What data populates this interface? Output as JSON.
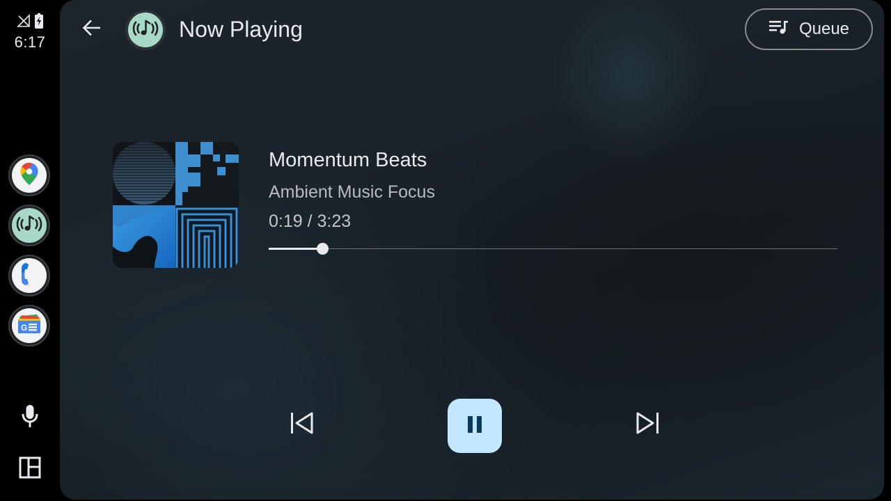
{
  "status_bar": {
    "time": "6:17",
    "icons": [
      "no-signal-icon",
      "battery-charging-icon"
    ]
  },
  "rail": {
    "apps": [
      {
        "name": "maps",
        "icon": "maps-icon"
      },
      {
        "name": "music",
        "icon": "music-app-icon"
      },
      {
        "name": "phone",
        "icon": "phone-icon"
      },
      {
        "name": "news",
        "icon": "news-icon"
      }
    ],
    "bottom": [
      "microphone-icon",
      "dashboard-icon"
    ]
  },
  "header": {
    "title": "Now Playing",
    "queue_label": "Queue"
  },
  "track": {
    "title": "Momentum Beats",
    "artist": "Ambient Music Focus",
    "time": "0:19 / 3:23",
    "progress": 0.094
  },
  "controls": [
    "skip-previous-icon",
    "pause-icon",
    "skip-next-icon"
  ],
  "colors": {
    "accent": "#c2e7ff",
    "music_icon_bg": "#a8d9c8"
  }
}
